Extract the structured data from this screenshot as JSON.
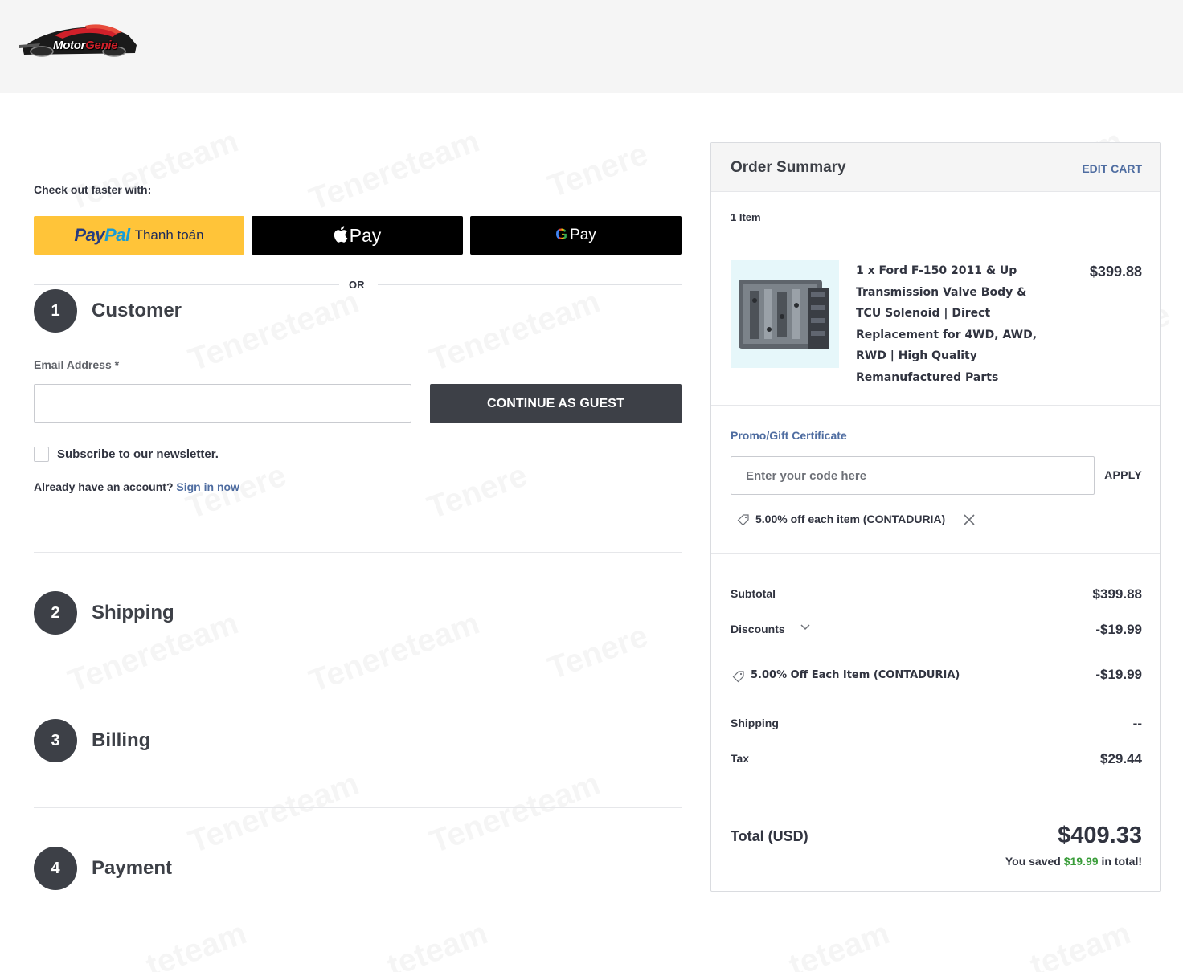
{
  "header": {
    "logo_text_part1": "Motor",
    "logo_text_part2": "Genie"
  },
  "checkout": {
    "faster_label": "Check out faster with:",
    "paypal_brand_part1": "Pay",
    "paypal_brand_part2": "Pal",
    "paypal_sub": "Thanh toán",
    "applepay_label": "Pay",
    "gpay_g": "G",
    "gpay_label": "Pay",
    "or_label": "OR"
  },
  "steps": [
    {
      "number": "1",
      "title": "Customer"
    },
    {
      "number": "2",
      "title": "Shipping"
    },
    {
      "number": "3",
      "title": "Billing"
    },
    {
      "number": "4",
      "title": "Payment"
    }
  ],
  "customer": {
    "email_label": "Email Address *",
    "email_value": "",
    "continue_label": "CONTINUE AS GUEST",
    "newsletter_label": "Subscribe to our newsletter.",
    "account_prompt": "Already have an account?",
    "signin_label": "Sign in now"
  },
  "summary": {
    "title": "Order Summary",
    "edit_cart": "EDIT CART",
    "item_count": "1 Item",
    "product": {
      "name": "1 x Ford F-150 2011 & Up Transmission Valve Body & TCU Solenoid | Direct Replacement for 4WD, AWD, RWD | High Quality Remanufactured Parts",
      "price": "$399.88"
    },
    "promo_label": "Promo/Gift Certificate",
    "promo_placeholder": "Enter your code here",
    "apply_label": "APPLY",
    "applied_coupon": "5.00% off each item (CONTADURIA)",
    "subtotal_label": "Subtotal",
    "subtotal_value": "$399.88",
    "discounts_label": "Discounts",
    "discounts_value": "-$19.99",
    "discount_line_label": "5.00% Off Each Item (CONTADURIA)",
    "discount_line_value": "-$19.99",
    "shipping_label": "Shipping",
    "shipping_value": "--",
    "tax_label": "Tax",
    "tax_value": "$29.44",
    "total_label": "Total (USD)",
    "total_value": "$409.33",
    "saved_prefix": "You saved",
    "saved_amount": "$19.99",
    "saved_suffix": "in total!"
  },
  "colors": {
    "dark": "#3d4047",
    "link": "#4f6da1",
    "paypal_yellow": "#ffc439",
    "savings_green": "#3a9d3a"
  }
}
